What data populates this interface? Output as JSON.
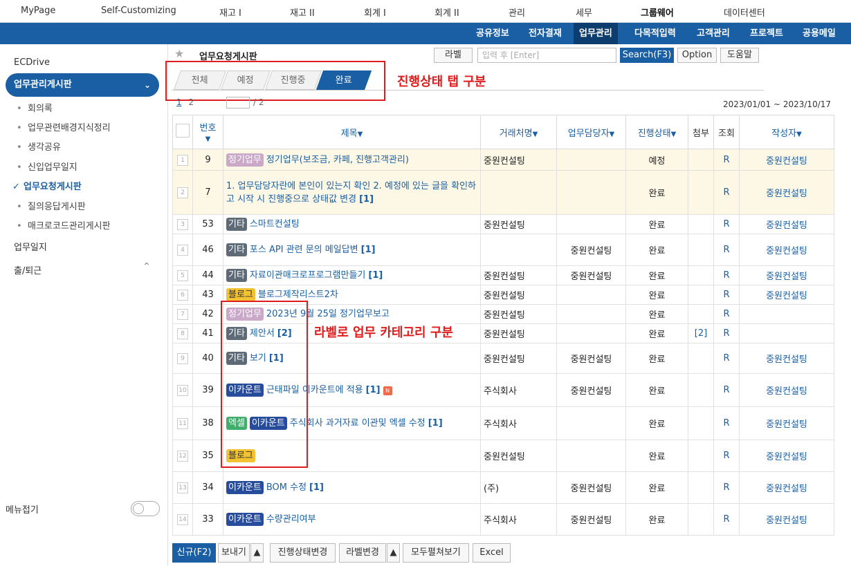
{
  "topnav": [
    "MyPage",
    "Self-Customizing",
    "재고 I",
    "재고 II",
    "회계 I",
    "회계 II",
    "관리",
    "세무",
    "그룹웨어",
    "데이터센터"
  ],
  "subnav": [
    "공유정보",
    "전자결재",
    "업무관리",
    "다목적입력",
    "고객관리",
    "프로젝트",
    "공용메일"
  ],
  "sidebar": {
    "ecdrive": "ECDrive",
    "group": "업무관리게시판",
    "items": [
      "회의록",
      "업무관련배경지식정리",
      "생각공유",
      "신입업무일지",
      "업무요청게시판",
      "질의응답게시판",
      "매크로코드관리게시판"
    ],
    "work_log": "업무일지",
    "attendance": "출/퇴근",
    "menu_fold": "메뉴접기"
  },
  "header": {
    "title": "업무요청게시판",
    "label_btn": "라벨",
    "search_placeholder": "입력 후 [Enter]",
    "search_btn": "Search(F3)",
    "option_btn": "Option",
    "help_btn": "도움말"
  },
  "tabs": [
    "전체",
    "예정",
    "진행중",
    "완료"
  ],
  "annotations": {
    "tabs_note": "진행상태 탭 구분",
    "labels_note": "라벨로 업무 카테고리 구분"
  },
  "paging": {
    "p1": "1",
    "p2": "2",
    "count": "/ 2",
    "date_range": "2023/01/01 ~ 2023/10/17"
  },
  "columns": {
    "no": "번호",
    "title": "제목",
    "client": "거래처명",
    "manager": "업무담당자",
    "status": "진행상태",
    "attach": "첨부",
    "view": "조회",
    "author": "작성자"
  },
  "rows": [
    {
      "idx": "1",
      "no": "9",
      "labels": [
        "정기업무"
      ],
      "title": "정기업무(보조금, 카페, 진행고객관리)",
      "client": "중원컨설팅",
      "manager": "",
      "status": "예정",
      "attach": "",
      "view": "R",
      "author": "중원컨설팅"
    },
    {
      "idx": "2",
      "no": "7",
      "labels": [],
      "title": "1. 업무담당자란에 본인이 있는지 확인 2. 예정에 있는 글을 확인하고 시작 시 진행중으로 상태값 변경",
      "comments": "[1]",
      "client": "",
      "manager": "",
      "status": "완료",
      "attach": "",
      "view": "R",
      "author": "중원컨설팅"
    },
    {
      "idx": "3",
      "no": "53",
      "labels": [
        "기타"
      ],
      "title": "스마트컨설팅",
      "client": "중원컨설팅",
      "manager": "",
      "status": "완료",
      "attach": "",
      "view": "R",
      "author": "중원컨설팅"
    },
    {
      "idx": "4",
      "no": "46",
      "labels": [
        "기타"
      ],
      "title": "포스 API 관련 문의 메일답변",
      "comments": "[1]",
      "client": "",
      "manager": "중원컨설팅",
      "status": "완료",
      "attach": "",
      "view": "R",
      "author": "중원컨설팅"
    },
    {
      "idx": "5",
      "no": "44",
      "labels": [
        "기타"
      ],
      "title": "자료이관매크로프로그램만들기",
      "comments": "[1]",
      "client": "중원컨설팅",
      "manager": "중원컨설팅",
      "status": "완료",
      "attach": "",
      "view": "R",
      "author": "중원컨설팅"
    },
    {
      "idx": "6",
      "no": "43",
      "labels": [
        "블로그"
      ],
      "title": "블로그제작리스트2차",
      "client": "중원컨설팅",
      "manager": "",
      "status": "완료",
      "attach": "",
      "view": "R",
      "author": "중원컨설팅"
    },
    {
      "idx": "7",
      "no": "42",
      "labels": [
        "정기업무"
      ],
      "title": "2023년 9월 25일 정기업무보고",
      "client": "중원컨설팅",
      "manager": "",
      "status": "완료",
      "attach": "",
      "view": "R",
      "author": ""
    },
    {
      "idx": "8",
      "no": "41",
      "labels": [
        "기타"
      ],
      "title": "제안서",
      "comments": "[2]",
      "client": "중원컨설팅",
      "manager": "",
      "status": "완료",
      "attach": "[2]",
      "view": "R",
      "author": ""
    },
    {
      "idx": "9",
      "no": "40",
      "labels": [
        "기타"
      ],
      "title": "보기",
      "comments": "[1]",
      "client": "중원컨설팅",
      "manager": "중원컨설팅",
      "status": "완료",
      "attach": "",
      "view": "R",
      "author": "중원컨설팅"
    },
    {
      "idx": "10",
      "no": "39",
      "labels": [
        "이카운트"
      ],
      "title": "근태파일 이카운트에 적용",
      "comments": "[1]",
      "new": "N",
      "client": "주식회사",
      "manager": "중원컨설팅",
      "status": "완료",
      "attach": "",
      "view": "R",
      "author": "중원컨설팅"
    },
    {
      "idx": "11",
      "no": "38",
      "labels": [
        "엑셀",
        "이카운트"
      ],
      "title": "주식회사 과거자료 이관및 엑셀 수정",
      "comments": "[1]",
      "client": "주식회사",
      "manager": "",
      "status": "완료",
      "attach": "",
      "view": "R",
      "author": "중원컨설팅"
    },
    {
      "idx": "12",
      "no": "35",
      "labels": [
        "블로그"
      ],
      "title": "",
      "client": "중원컨설팅",
      "manager": "",
      "status": "완료",
      "attach": "",
      "view": "R",
      "author": "중원컨설팅"
    },
    {
      "idx": "13",
      "no": "34",
      "labels": [
        "이카운트"
      ],
      "title": "BOM 수정",
      "comments": "[1]",
      "client": "(주)",
      "manager": "중원컨설팅",
      "status": "완료",
      "attach": "",
      "view": "R",
      "author": "중원컨설팅"
    },
    {
      "idx": "14",
      "no": "33",
      "labels": [
        "이카운트"
      ],
      "title": "수량관리여부",
      "client": "주식회사",
      "manager": "중원컨설팅",
      "status": "완료",
      "attach": "",
      "view": "R",
      "author": "중원컨설팅"
    }
  ],
  "label_colors": {
    "정기업무": "#c9a9c7",
    "기타": "#5f6a77",
    "블로그": "#f2c232",
    "이카운트": "#274c9b",
    "엑셀": "#3fae6a"
  },
  "footer": [
    "신규(F2)",
    "보내기",
    "진행상태변경",
    "라벨변경",
    "모두펼쳐보기",
    "Excel"
  ],
  "colors": {
    "brand": "#1a5fa3",
    "annotation": "#e01b1b"
  }
}
